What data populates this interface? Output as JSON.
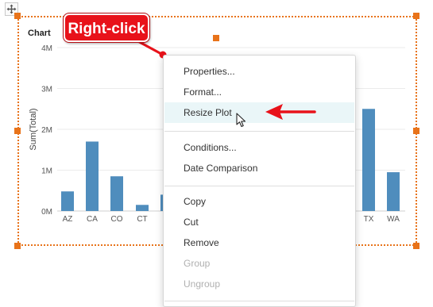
{
  "chart": {
    "title": "Chart"
  },
  "chart_data": {
    "type": "bar",
    "ylabel": "Sum(Total)",
    "ylim": [
      0,
      4000000
    ],
    "y_ticks": [
      "0M",
      "1M",
      "2M",
      "3M",
      "4M"
    ],
    "categories": [
      "AZ",
      "CA",
      "CO",
      "CT",
      "",
      "TX",
      "WA"
    ],
    "values": [
      480000,
      1700000,
      850000,
      150000,
      400000,
      2500000,
      950000
    ],
    "colors": {
      "bar": "#4f8dbd",
      "grid": "#ebebeb",
      "axis": "#cfcfcf"
    }
  },
  "callout": {
    "label": "Right-click"
  },
  "context_menu": {
    "items": [
      {
        "label": "Properties...",
        "disabled": false
      },
      {
        "label": "Format...",
        "disabled": false
      },
      {
        "label": "Resize Plot",
        "disabled": false,
        "highlighted": true
      },
      {
        "label": "Conditions...",
        "disabled": false
      },
      {
        "label": "Date Comparison",
        "disabled": false
      },
      {
        "label": "Copy",
        "disabled": false
      },
      {
        "label": "Cut",
        "disabled": false
      },
      {
        "label": "Remove",
        "disabled": false
      },
      {
        "label": "Group",
        "disabled": true
      },
      {
        "label": "Ungroup",
        "disabled": true
      }
    ]
  },
  "icons": {
    "move": "move-arrows-icon",
    "cursor": "mouse-pointer-icon",
    "arrow": "red-left-arrow-icon"
  },
  "colors": {
    "selection": "#e8731a",
    "callout": "#e8121a",
    "hover": "#eaf6f8"
  }
}
